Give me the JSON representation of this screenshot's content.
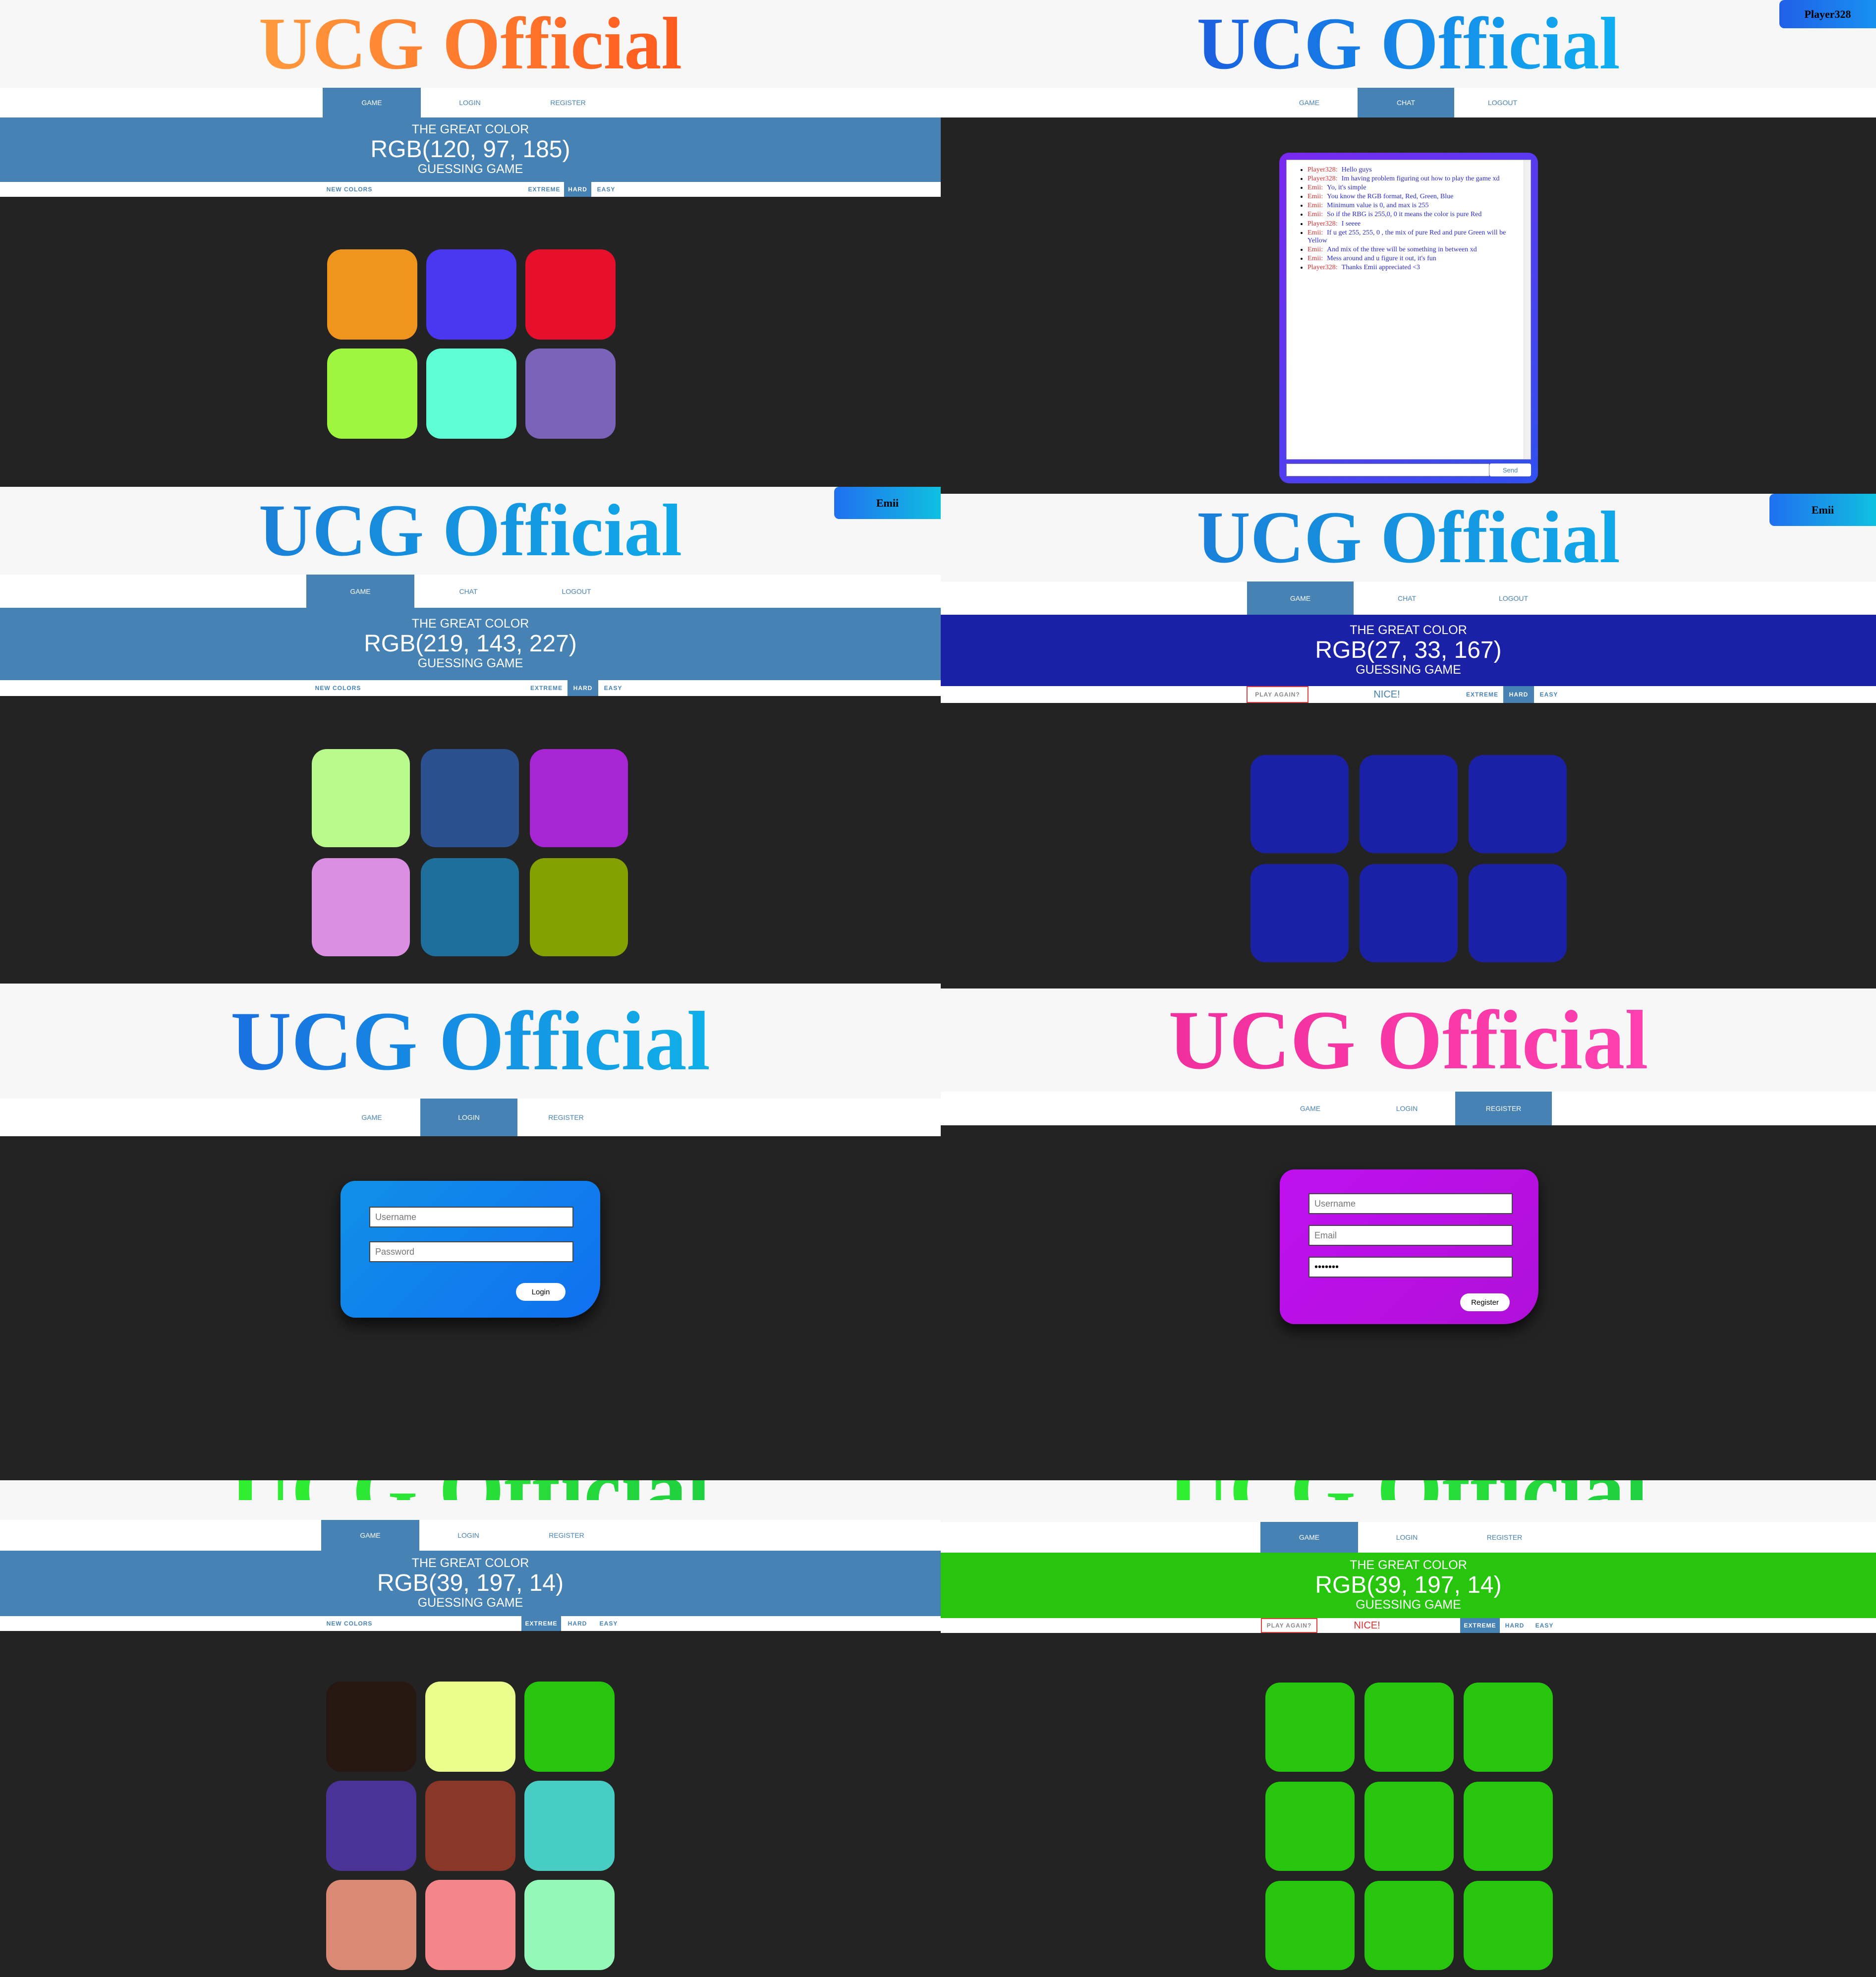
{
  "app_title": "UCG Official",
  "header": {
    "top": "THE GREAT COLOR",
    "bottom": "GUESSING GAME"
  },
  "panels": {
    "p1": {
      "title_colors": [
        "#ff9a3c",
        "#ff5a1f"
      ],
      "tabs": [
        "GAME",
        "LOGIN",
        "REGISTER"
      ],
      "rgb": "RGB(120, 97, 185)",
      "header_bg": "#4682b4",
      "controls": {
        "new_colors": "NEW COLORS",
        "extreme": "EXTREME",
        "hard": "HARD",
        "easy": "EASY"
      },
      "squares": [
        "#ef941c",
        "#4a37f2",
        "#e60f2c",
        "#9ef63f",
        "#5ffdd6",
        "#7a63b9"
      ]
    },
    "p2": {
      "title_colors": [
        "#1a5fe0",
        "#10b0f0"
      ],
      "user": "Player328",
      "tabs": [
        "GAME",
        "CHAT",
        "LOGOUT"
      ],
      "chat": [
        {
          "name": "Player328:",
          "text": "Hello guys"
        },
        {
          "name": "Player328:",
          "text": "Im having problem figuring out how to play the game xd"
        },
        {
          "name": "Emii:",
          "text": "Yo, it's simple"
        },
        {
          "name": "Emii:",
          "text": "You know the RGB format, Red, Green, Blue"
        },
        {
          "name": "Emii:",
          "text": "Minimum value is 0, and max is 255"
        },
        {
          "name": "Emii:",
          "text": "So if the RBG is 255,0, 0 it means the color is pure Red"
        },
        {
          "name": "Player328:",
          "text": "I seeee"
        },
        {
          "name": "Emii:",
          "text": "If u get 255, 255, 0 , the mix of pure Red and pure Green will be Yellow"
        },
        {
          "name": "Emii:",
          "text": "And mix of the three will be something in between xd"
        },
        {
          "name": "Emii:",
          "text": "Mess around and u figure it out, it's fun"
        },
        {
          "name": "Player328:",
          "text": "Thanks Emii appreciated <3"
        }
      ],
      "send": "Send"
    },
    "p3": {
      "title_colors": [
        "#1a80d8",
        "#10a8e8"
      ],
      "user": "Emii",
      "tabs": [
        "GAME",
        "CHAT",
        "LOGOUT"
      ],
      "rgb": "RGB(219, 143, 227)",
      "header_bg": "#4682b4",
      "controls": {
        "new_colors": "NEW COLORS",
        "extreme": "EXTREME",
        "hard": "HARD",
        "easy": "EASY"
      },
      "squares": [
        "#baf98c",
        "#2a508f",
        "#a725d3",
        "#db8fe3",
        "#1f6f9c",
        "#84a001"
      ]
    },
    "p4": {
      "title_colors": [
        "#1a80d8",
        "#10a8e8"
      ],
      "user": "Emii",
      "tabs": [
        "GAME",
        "CHAT",
        "LOGOUT"
      ],
      "rgb": "RGB(27, 33, 167)",
      "header_bg": "#1b21a7",
      "controls": {
        "play_again": "PLAY AGAIN?",
        "message": "NICE!",
        "extreme": "EXTREME",
        "hard": "HARD",
        "easy": "EASY"
      },
      "message_color": "#4682b4",
      "squares": [
        "#1b21a7",
        "#1b21a7",
        "#1b21a7",
        "#1b21a7",
        "#1b21a7",
        "#1b21a7"
      ]
    },
    "p5": {
      "title_colors": [
        "#1a70e0",
        "#10b0e8"
      ],
      "tabs": [
        "GAME",
        "LOGIN",
        "REGISTER"
      ],
      "form": {
        "username_placeholder": "Username",
        "password_placeholder": "Password",
        "button": "Login"
      }
    },
    "p6": {
      "title_colors": [
        "#f0309c",
        "#ff40b0"
      ],
      "tabs": [
        "GAME",
        "LOGIN",
        "REGISTER"
      ],
      "form": {
        "username_placeholder": "Username",
        "email_placeholder": "Email",
        "password_value": "•••••••",
        "button": "Register"
      }
    },
    "p7": {
      "title_colors": [
        "#30f030",
        "#20d040"
      ],
      "tabs": [
        "GAME",
        "LOGIN",
        "REGISTER"
      ],
      "rgb": "RGB(39, 197, 14)",
      "header_bg": "#4682b4",
      "controls": {
        "new_colors": "NEW COLORS",
        "extreme": "EXTREME",
        "hard": "HARD",
        "easy": "EASY"
      },
      "squares": [
        "#261710",
        "#eafd8d",
        "#27c50e",
        "#4b3296",
        "#8a372a",
        "#48cdc4",
        "#da8a74",
        "#f48689",
        "#93f8b8"
      ]
    },
    "p8": {
      "title_colors": [
        "#30f030",
        "#20d040"
      ],
      "tabs": [
        "GAME",
        "LOGIN",
        "REGISTER"
      ],
      "rgb": "RGB(39, 197, 14)",
      "header_bg": "#27c50e",
      "controls": {
        "play_again": "PLAY AGAIN?",
        "message": "NICE!",
        "extreme": "EXTREME",
        "hard": "HARD",
        "easy": "EASY"
      },
      "message_color": "#e03030",
      "squares": [
        "#27c50e",
        "#27c50e",
        "#27c50e",
        "#27c50e",
        "#27c50e",
        "#27c50e",
        "#27c50e",
        "#27c50e",
        "#27c50e"
      ]
    }
  }
}
